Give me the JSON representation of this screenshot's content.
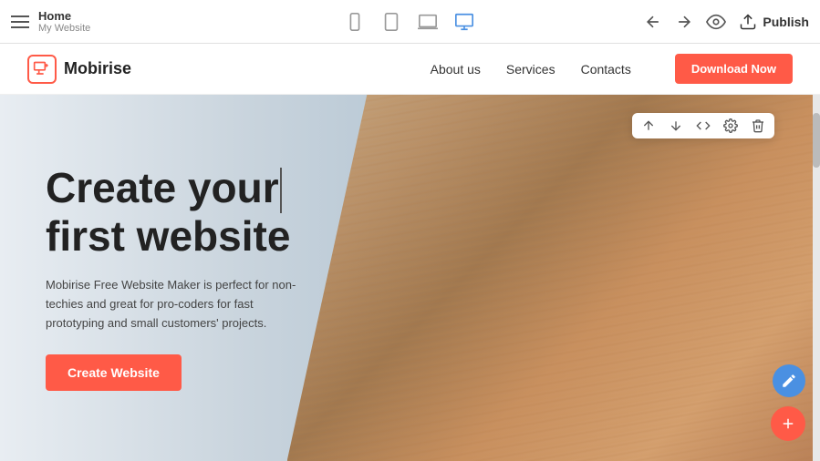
{
  "toolbar": {
    "home_title": "Home",
    "home_subtitle": "My Website",
    "devices": [
      {
        "id": "mobile",
        "label": "Mobile"
      },
      {
        "id": "tablet",
        "label": "Tablet"
      },
      {
        "id": "laptop",
        "label": "Laptop"
      },
      {
        "id": "desktop",
        "label": "Desktop",
        "active": true
      }
    ],
    "back_label": "Back",
    "forward_label": "Forward",
    "preview_label": "Preview",
    "publish_label": "Publish"
  },
  "site": {
    "logo_text": "Mobirise",
    "nav": {
      "about": "About us",
      "services": "Services",
      "contacts": "Contacts",
      "download_btn": "Download Now"
    },
    "hero": {
      "title_line1": "Create your",
      "title_line2": "first website",
      "description": "Mobirise Free Website Maker is perfect for non-techies and great for pro-coders for fast prototyping and small customers' projects.",
      "cta_label": "Create Website"
    }
  },
  "float_toolbar": {
    "up_icon": "↑",
    "down_icon": "↓",
    "code_icon": "</>",
    "settings_icon": "⚙",
    "delete_icon": "🗑"
  },
  "colors": {
    "accent": "#ff5a47",
    "blue": "#4a90e2"
  }
}
